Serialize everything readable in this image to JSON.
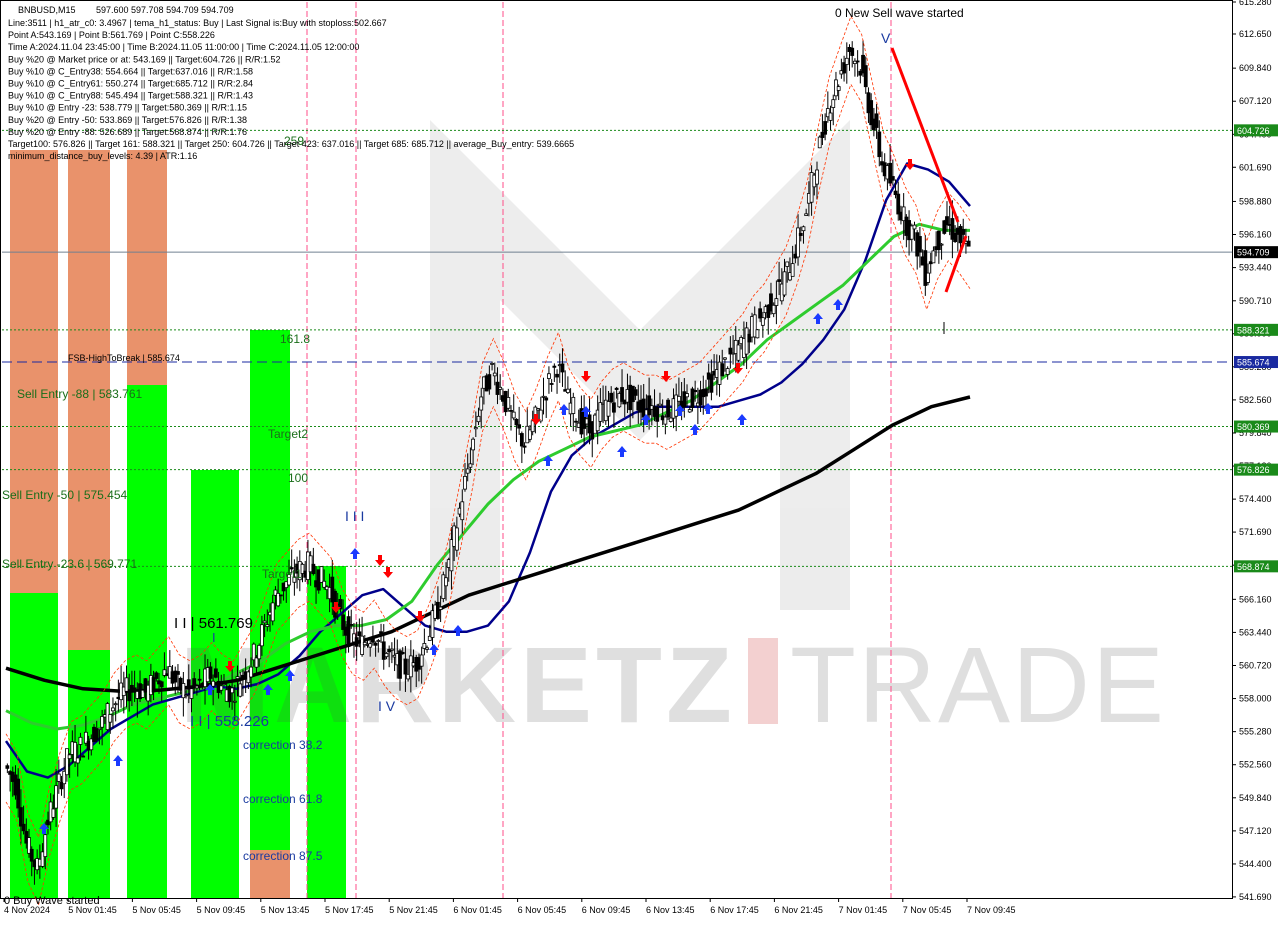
{
  "window": {
    "title": "BNBUSD,M15",
    "ohlc": "597.600 597.708 594.709 594.709"
  },
  "info_lines": [
    "Line:3511 | h1_atr_c0: 3.4967 | tema_h1_status: Buy | Last Signal is:Buy with stoploss:502.667",
    "Point A:543.169 | Point B:561.769 | Point C:558.226",
    "Time A:2024.11.04 23:45:00 | Time B:2024.11.05 11:00:00 | Time C:2024.11.05 12:00:00",
    "Buy %20 @ Market price or at: 543.169 || Target:604.726 || R/R:1.52",
    "Buy %10 @ C_Entry38: 554.664 || Target:637.016 || R/R:1.58",
    "Buy %10 @ C_Entry61: 550.274 || Target:685.712 || R/R:2.84",
    "Buy %10 @ C_Entry88: 545.494 || Target:588.321 || R/R:1.43",
    "Buy %10 @ Entry -23: 538.779 || Target:580.369 || R/R:1.15",
    "Buy %20 @ Entry -50: 533.869 || Target:576.826 || R/R:1.38",
    "Buy %20 @ Entry -88: 526.689 || Target:568.874 || R/R:1.76",
    "Target100: 576.826 || Target 161: 588.321 || Target 250: 604.726 || Target 423: 637.016 || Target 685: 685.712 || average_Buy_entry: 539.6665",
    "minimum_distance_buy_levels: 4.39 | ATR:1.16"
  ],
  "annotations": {
    "wave_started": "0 New Sell wave started",
    "fsb": "FSB-HighToBreak | 585.674",
    "sell_88": "Sell Entry -88 | 583.761",
    "sell_50": "Sell Entry -50 | 575.454",
    "sell_23": "Sell Entry -23.6 | 569.771",
    "point_b": "I I | 561.769",
    "point_c": "I I | 558.226",
    "lvl_161": "161.8",
    "lvl_100": "100",
    "target2": "Target2",
    "target1": "Target1",
    "lvl_259": "259",
    "corr_38": "correction 38.2",
    "corr_61": "correction 61.8",
    "corr_87": "correction 87.5",
    "wave_i": "I I I",
    "wave_iv": "I V",
    "wave_v": "V",
    "wave_i_small": "I",
    "bottom_label": "0 Buy Wave started"
  },
  "colors": {
    "bg": "#ffffff",
    "green_zone": "#00ff00",
    "orange_zone": "#e9926b",
    "level_green": "#1a8a1a",
    "level_blue": "#1a2aa0",
    "bull": "#000000",
    "bear": "#000000",
    "ema_fast": "#00008b",
    "ema_mid": "#2ecc2e",
    "ema_slow": "#000000",
    "channel": "#ff3300",
    "sell_line": "#ff0000",
    "current_price_line": "#708090"
  },
  "chart_data": {
    "type": "candlestick",
    "symbol": "BNBUSD",
    "timeframe": "M15",
    "ylim": [
      541.6,
      615.28
    ],
    "y_ticks": [
      615.28,
      612.65,
      609.84,
      607.12,
      604.4,
      601.69,
      598.88,
      596.16,
      593.44,
      590.71,
      588.0,
      585.28,
      582.56,
      579.84,
      577.12,
      574.4,
      571.69,
      568.97,
      566.16,
      563.44,
      560.72,
      558.0,
      555.28,
      552.56,
      549.84,
      547.12,
      544.4,
      541.69
    ],
    "x_ticks": [
      "4 Nov 2024",
      "5 Nov 01:45",
      "5 Nov 05:45",
      "5 Nov 09:45",
      "5 Nov 13:45",
      "5 Nov 17:45",
      "5 Nov 21:45",
      "6 Nov 01:45",
      "6 Nov 05:45",
      "6 Nov 09:45",
      "6 Nov 13:45",
      "6 Nov 17:45",
      "6 Nov 21:45",
      "7 Nov 01:45",
      "7 Nov 05:45",
      "7 Nov 09:45"
    ],
    "levels": [
      {
        "price": 604.726,
        "label": "604.726",
        "style": "dotted",
        "color": "#1a8a1a"
      },
      {
        "price": 588.321,
        "label": "588.321",
        "style": "dotted",
        "color": "#1a8a1a"
      },
      {
        "price": 585.674,
        "label": "585.674",
        "style": "dashed",
        "color": "#1a2aa0"
      },
      {
        "price": 580.369,
        "label": "580.369",
        "style": "dotted",
        "color": "#1a8a1a"
      },
      {
        "price": 576.826,
        "label": "576.826",
        "style": "dotted",
        "color": "#1a8a1a"
      },
      {
        "price": 568.874,
        "label": "568.874",
        "style": "dotted",
        "color": "#1a8a1a"
      },
      {
        "price": 594.709,
        "label": "594.709",
        "style": "solid",
        "color": "#708090",
        "current": true
      }
    ],
    "price_path": [
      552.5,
      551.0,
      546.0,
      544.0,
      548.0,
      551.0,
      553.5,
      554.0,
      555.0,
      556.0,
      557.5,
      558.5,
      559.0,
      558.5,
      559.5,
      560.5,
      559.0,
      558.5,
      559.0,
      560.0,
      559.0,
      558.5,
      560.0,
      561.5,
      564.0,
      566.5,
      567.5,
      568.5,
      569.0,
      568.0,
      567.0,
      564.5,
      563.0,
      562.5,
      563.5,
      562.0,
      561.0,
      560.5,
      561.0,
      563.0,
      565.5,
      569.0,
      573.5,
      578.0,
      583.0,
      585.0,
      583.0,
      580.5,
      579.0,
      581.0,
      583.5,
      585.5,
      582.5,
      581.0,
      580.0,
      581.5,
      582.5,
      583.0,
      582.5,
      582.0,
      582.0,
      581.5,
      582.0,
      582.5,
      583.0,
      584.0,
      585.0,
      586.0,
      587.0,
      588.5,
      589.5,
      591.0,
      592.5,
      595.0,
      598.0,
      602.5,
      606.5,
      609.0,
      611.5,
      610.0,
      606.0,
      602.0,
      600.0,
      597.5,
      596.0,
      593.0,
      595.5,
      597.0,
      596.0,
      594.7
    ],
    "series": [
      {
        "name": "ema_fast",
        "values": [
          554.5,
          552.0,
          551.5,
          552.5,
          554.0,
          555.5,
          556.5,
          557.5,
          558.0,
          558.5,
          559.0,
          558.8,
          559.2,
          560.0,
          561.5,
          563.5,
          565.0,
          566.5,
          567.0,
          565.5,
          564.0,
          563.5,
          563.5,
          564.0,
          566.0,
          570.0,
          575.0,
          578.0,
          579.5,
          580.5,
          581.5,
          582.0,
          582.0,
          582.0,
          582.0,
          582.5,
          583.0,
          584.0,
          585.5,
          587.5,
          590.0,
          594.0,
          599.0,
          602.0,
          601.5,
          600.5,
          598.5
        ]
      },
      {
        "name": "ema_mid",
        "values": [
          557.0,
          556.0,
          555.5,
          555.8,
          556.5,
          557.5,
          558.0,
          558.5,
          559.0,
          560.0,
          561.0,
          562.5,
          563.5,
          564.0,
          564.0,
          564.5,
          566.0,
          569.0,
          571.5,
          574.0,
          576.0,
          577.5,
          578.5,
          579.5,
          580.0,
          580.5,
          581.5,
          582.5,
          584.0,
          585.5,
          587.5,
          589.0,
          590.5,
          592.0,
          594.0,
          596.0,
          597.0,
          596.5,
          596.5
        ]
      },
      {
        "name": "ema_slow",
        "values": [
          560.5,
          559.5,
          558.8,
          558.6,
          558.7,
          559.0,
          559.5,
          560.5,
          561.5,
          562.5,
          563.5,
          565.0,
          566.5,
          567.5,
          568.5,
          569.5,
          570.5,
          571.5,
          572.5,
          573.5,
          575.0,
          576.5,
          578.5,
          580.5,
          582.0,
          582.8
        ]
      }
    ]
  }
}
